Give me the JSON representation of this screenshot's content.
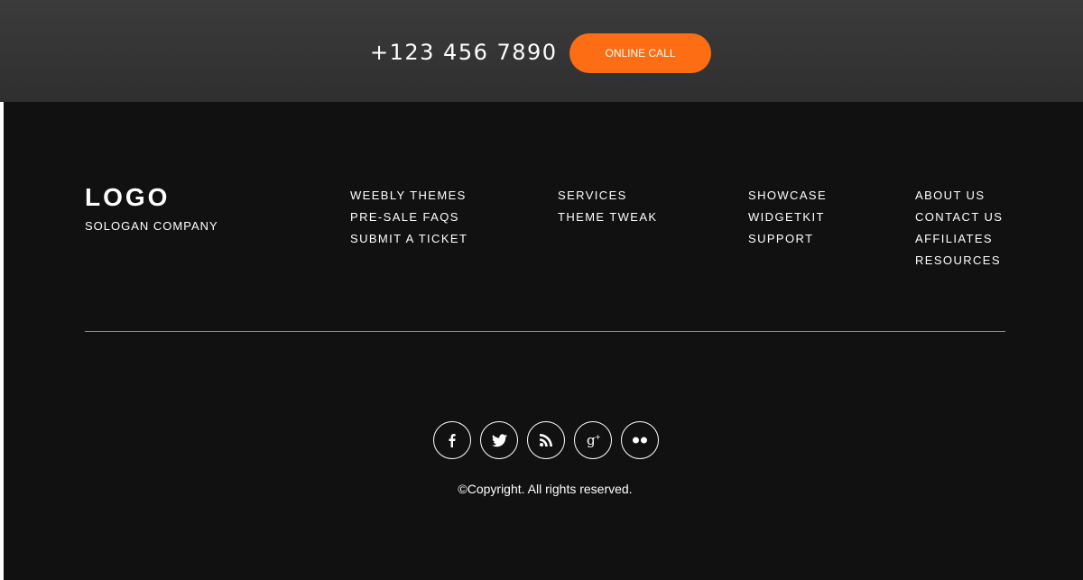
{
  "topbar": {
    "phone": "+123 456 7890",
    "call_button": "ONLINE CALL"
  },
  "footer": {
    "logo": "LOGO",
    "slogan": "SOLOGAN COMPANY",
    "columns": [
      {
        "links": [
          "WEEBLY THEMES",
          "PRE-SALE FAQS",
          "SUBMIT A TICKET"
        ]
      },
      {
        "links": [
          "SERVICES",
          "THEME TWEAK"
        ]
      },
      {
        "links": [
          "SHOWCASE",
          "WIDGETKIT",
          "SUPPORT"
        ]
      },
      {
        "links": [
          "ABOUT US",
          "CONTACT US",
          "AFFILIATES",
          "RESOURCES"
        ]
      }
    ],
    "social_icons": [
      "facebook-icon",
      "twitter-icon",
      "rss-icon",
      "google-plus-icon",
      "flickr-icon"
    ],
    "copyright": "©Copyright. All rights reserved."
  },
  "colors": {
    "accent": "#fc6d14",
    "topbar_bg": "#333333",
    "footer_bg": "#111111"
  }
}
